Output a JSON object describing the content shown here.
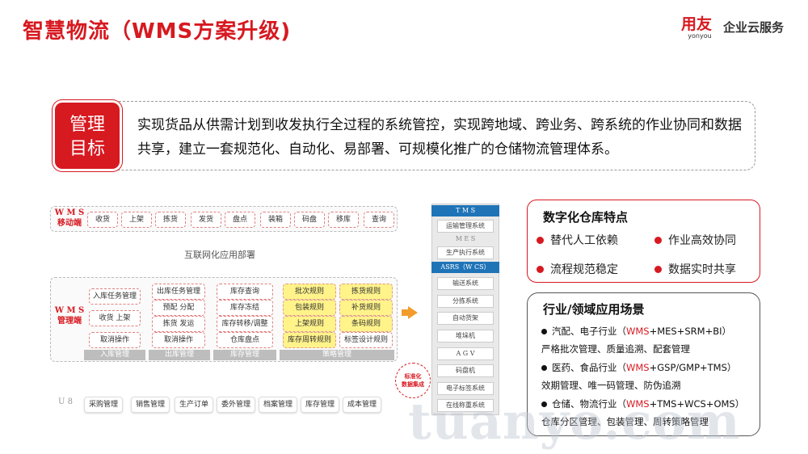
{
  "header": {
    "title": "智慧物流（WMS方案升级)",
    "logo_main": "用友",
    "logo_sub": "yonyou",
    "logo_service": "企业云服务"
  },
  "goal": {
    "label_line1": "管理",
    "label_line2": "目标",
    "text": "实现货品从供需计划到收发执行全过程的系统管控，实现跨地域、跨业务、跨系统的作业协同和数据共享，建立一套规范化、自动化、易部署、可规模化推广的仓储物流管理体系。"
  },
  "mobile": {
    "label_line1": "W M S",
    "label_line2": "移动端",
    "items": [
      "收货",
      "上架",
      "拣货",
      "发货",
      "盘点",
      "装箱",
      "码盘",
      "移库",
      "查询"
    ]
  },
  "internet_label": "互联网化应用部署",
  "wms_mgmt": {
    "label_line1": "W M S",
    "label_line2": "管理端",
    "col1": [
      "入库任务管理",
      "收货 上架",
      "取消操作"
    ],
    "col2": [
      "出库任务管理",
      "预配 分配",
      "拣货 发运",
      "取消操作"
    ],
    "col3": [
      "库存查询",
      "库存冻结",
      "库存转移/调整",
      "仓库盘点"
    ],
    "col4": [
      "批次规则",
      "包装规则",
      "上架规则",
      "库存周转规则"
    ],
    "col5": [
      "拣货规则",
      "补货规则",
      "条码规则",
      "标签设计规则"
    ],
    "bars": [
      "入库管理",
      "出库管理",
      "库存管理",
      "策略管理"
    ]
  },
  "u8": {
    "label": "U 8",
    "items": [
      "采购管理",
      "销售管理",
      "生产订单",
      "委外管理",
      "档案管理",
      "库存管理",
      "成本管理"
    ]
  },
  "stack": {
    "tms_head": "T M S",
    "tms_item": "运输管理系统",
    "mes_label": "M E S",
    "mes_item": "生产执行系统",
    "asrs_head": "ASRS（W CS）",
    "asrs_items": [
      "输送系统",
      "分拣系统",
      "自动货架",
      "堆垛机",
      "A G V",
      "码盘机",
      "电子标签系统",
      "在线称重系统"
    ]
  },
  "badge": {
    "line1": "标准化",
    "line2": "数据集成"
  },
  "features": {
    "title": "数字化仓库特点",
    "items": [
      "替代人工依赖",
      "作业高效协同",
      "流程规范稳定",
      "数据实时共享"
    ]
  },
  "scenarios": {
    "title": "行业/领域应用场景",
    "items": [
      {
        "lead": "汽配、电子行业（",
        "hl": "WMS",
        "tail": "+MES+SRM+BI）",
        "detail": "严格批次管理、质量追溯、配套管理"
      },
      {
        "lead": "医药、食品行业（",
        "hl": "WMS",
        "tail": "+GSP/GMP+TMS）",
        "detail": "效期管理、唯一码管理、防伪追溯"
      },
      {
        "lead": "仓储、物流行业（",
        "hl": "WMS",
        "tail": "+TMS+WCS+OMS）",
        "detail": "仓库分区管理、包装管理、周转策略管理"
      }
    ]
  },
  "watermark": "tuanyo.com",
  "colors": {
    "brand_red": "#d71920",
    "asrs_blue": "#1f74b8",
    "arrow_orange": "#f39c2c",
    "rule_yellow": "#fff38a"
  }
}
